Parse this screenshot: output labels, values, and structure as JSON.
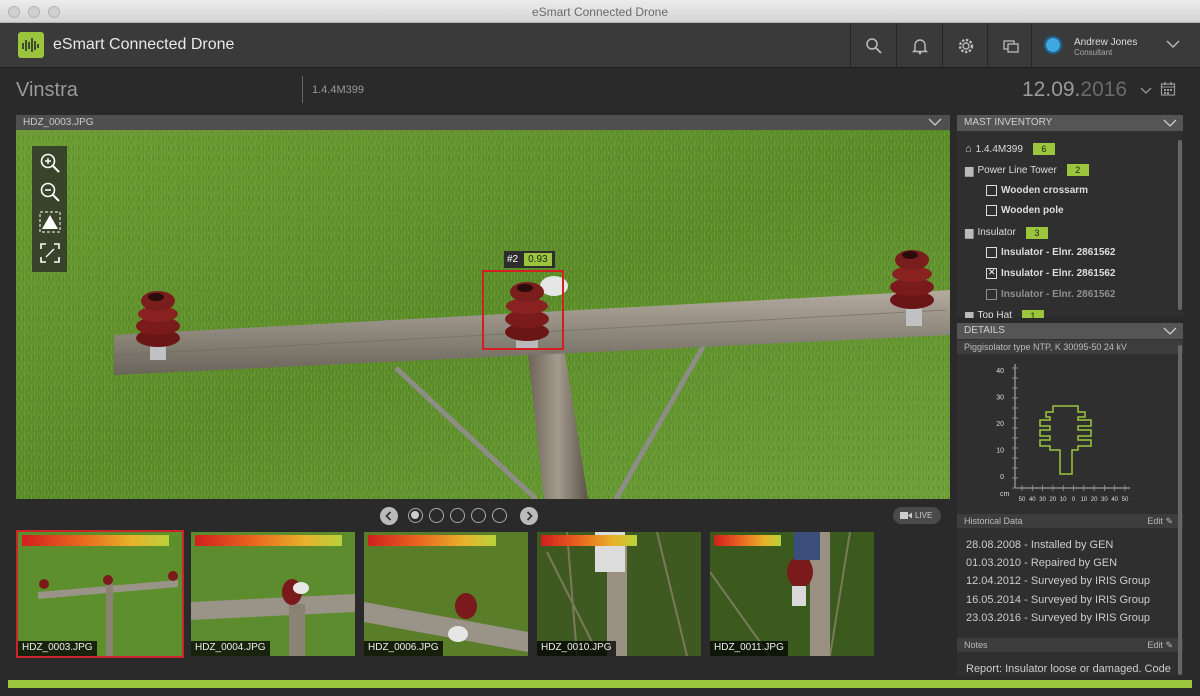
{
  "window": {
    "title": "eSmart Connected Drone"
  },
  "app": {
    "brand": "eSmart Connected Drone"
  },
  "user": {
    "name": "Andrew Jones",
    "role": "Consultant"
  },
  "header": {
    "location": "Vinstra",
    "code": "1.4.4M399",
    "date_main": "12.09.",
    "date_year": "2016"
  },
  "viewer": {
    "filename": "HDZ_0003.JPG",
    "detection": {
      "label": "#2",
      "confidence": "0.93"
    },
    "live_label": "LIVE",
    "pages": 5,
    "active_page": 1
  },
  "thumbnails": [
    {
      "label": "HDZ_0003.JPG",
      "severity": 0.92,
      "selected": true
    },
    {
      "label": "HDZ_0004.JPG",
      "severity": 0.92,
      "selected": false
    },
    {
      "label": "HDZ_0006.JPG",
      "severity": 0.8,
      "selected": false
    },
    {
      "label": "HDZ_0010.JPG",
      "severity": 0.6,
      "selected": false
    },
    {
      "label": "HDZ_0011.JPG",
      "severity": 0.42,
      "selected": false
    }
  ],
  "inventory": {
    "title": "MAST INVENTORY",
    "root": {
      "label": "1.4.4M399",
      "count": "6"
    },
    "groups": [
      {
        "label": "Power Line Tower",
        "count": "2",
        "items": [
          {
            "label": "Wooden crossarm",
            "checked": false
          },
          {
            "label": "Wooden pole",
            "checked": false
          }
        ]
      },
      {
        "label": "Insulator",
        "count": "3",
        "items": [
          {
            "label": "Insulator - Elnr. 2861562",
            "checked": false
          },
          {
            "label": "Insulator - Elnr. 2861562",
            "checked": true
          },
          {
            "label": "Insulator - Elnr. 2861562",
            "checked": false
          }
        ]
      },
      {
        "label": "Top Hat",
        "count": "1",
        "items": []
      }
    ]
  },
  "details": {
    "title": "DETAILS",
    "subtitle": "Piggisolator type NTP, K 30095-50 24 kV",
    "chart_data": {
      "type": "diagram",
      "y_ticks": [
        "40",
        "30",
        "20",
        "10",
        "0"
      ],
      "y_unit": "cm",
      "x_ticks": [
        "50",
        "40",
        "30",
        "20",
        "10",
        "0",
        "10",
        "20",
        "30",
        "40",
        "50"
      ],
      "stroke_color": "#9bc53d"
    },
    "historical": {
      "title": "Historical Data",
      "edit_label": "Edit",
      "entries": [
        "28.08.2008 - Installed by GEN",
        "01.03.2010 - Repaired by GEN",
        "12.04.2012 - Surveyed by IRIS Group",
        "16.05.2014 - Surveyed by IRIS Group",
        "23.03.2016 - Surveyed by IRIS Group"
      ]
    },
    "notes": {
      "title": "Notes",
      "edit_label": "Edit",
      "text": "Report: Insulator loose or damaged. Code"
    }
  },
  "colors": {
    "accent": "#9bc53d",
    "alert": "#d31f1f",
    "panel": "#2f2f2f"
  }
}
